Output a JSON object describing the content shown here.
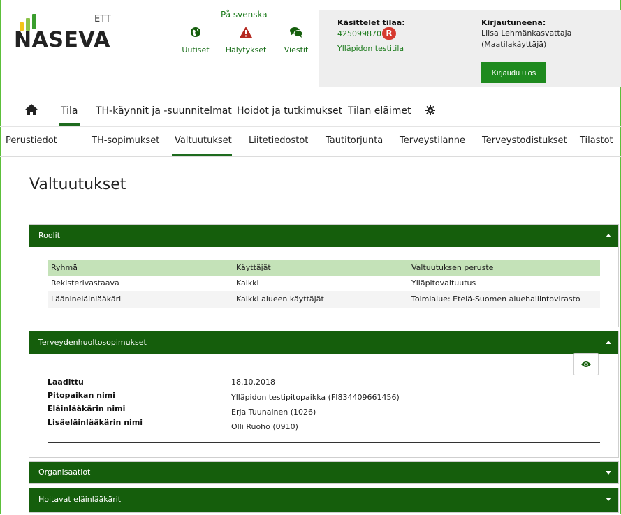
{
  "logo": {
    "ett": "ETT",
    "name": "NASEVA",
    "bar_colors": [
      "#f3c41a",
      "#8bc34a",
      "#3a9e2e"
    ]
  },
  "header": {
    "language_link": "På svenska",
    "nav": [
      {
        "label": "Uutiset",
        "icon": "globe-icon"
      },
      {
        "label": "Hälytykset",
        "icon": "warning-icon"
      },
      {
        "label": "Viestit",
        "icon": "chat-icon"
      }
    ]
  },
  "status": {
    "handling_label": "Käsittelet tilaa:",
    "farm_id": "425099870",
    "badge": "R",
    "farm_name": "Ylläpidon testitila",
    "logged_label": "Kirjautuneena:",
    "user_name": "Liisa Lehmänkasvattaja",
    "user_role": "(Maatilakäyttäjä)",
    "logout": "Kirjaudu ulos"
  },
  "main_nav": {
    "home_icon": "home-icon",
    "items": [
      "Tila",
      "TH-käynnit ja -suunnitelmat",
      "Hoidot ja tutkimukset",
      "Tilan eläimet"
    ],
    "settings_icon": "gear-icon",
    "active": "Tila"
  },
  "sub_nav": {
    "items": [
      "Perustiedot",
      "TH-sopimukset",
      "Valtuutukset",
      "Liitetiedostot",
      "Tautitorjunta",
      "Terveystilanne",
      "Terveystodistukset",
      "Tilastot"
    ],
    "active": "Valtuutukset"
  },
  "page_title": "Valtuutukset",
  "panels": {
    "roolit": {
      "title": "Roolit",
      "columns": [
        "Ryhmä",
        "Käyttäjät",
        "Valtuutuksen peruste"
      ],
      "rows": [
        [
          "Rekisterivastaava",
          "Kaikki",
          "Ylläpitovaltuutus"
        ],
        [
          "Läänineläinlääkäri",
          "Kaikki alueen käyttäjät",
          "Toimialue: Etelä-Suomen aluehallintovirasto"
        ]
      ]
    },
    "th": {
      "title": "Terveydenhuoltosopimukset",
      "fields": [
        {
          "label": "Laadittu",
          "value": "18.10.2018"
        },
        {
          "label": "Pitopaikan nimi",
          "value": "Ylläpidon testipitopaikka (FI834409661456)"
        },
        {
          "label": "Eläinlääkärin nimi",
          "value": "Erja Tuunainen (1026)"
        },
        {
          "label": "Lisäeläinlääkärin nimi",
          "value": "Olli Ruoho (0910)"
        }
      ],
      "view_icon": "eye-icon"
    },
    "organisaatiot": {
      "title": "Organisaatiot"
    },
    "hoitavat": {
      "title": "Hoitavat eläinlääkärit"
    }
  },
  "colors": {
    "brand_green": "#155e0c",
    "accent_green": "#1e8a1e",
    "table_header": "#c4e2b8",
    "badge_red": "#d63a2f"
  }
}
